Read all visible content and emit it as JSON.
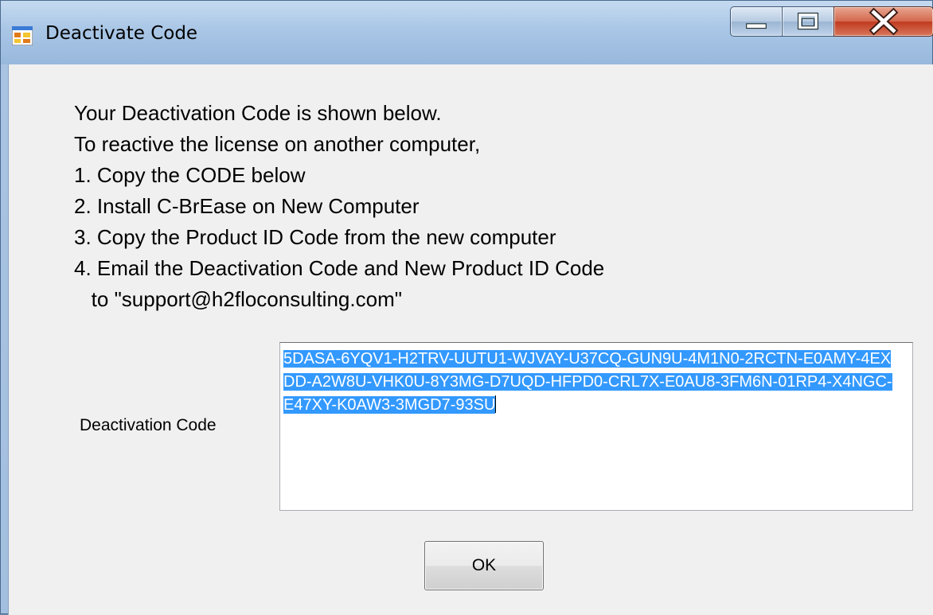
{
  "window": {
    "title": "Deactivate Code",
    "icon": "app-window-icon",
    "controls": [
      "minimize-icon",
      "maximize-icon",
      "close-icon"
    ]
  },
  "instructions": [
    "Your Deactivation Code is shown below.",
    "To reactive the license on another computer,",
    "1. Copy the CODE below",
    "2. Install C-BrEase on New Computer",
    "3. Copy the Product ID Code from the new computer",
    "4. Email the Deactivation Code and New Product ID Code",
    "   to \"support@h2floconsulting.com\""
  ],
  "deactivation": {
    "label": "Deactivation Code",
    "code": "5DASA-6YQV1-H2TRV-UUTU1-WJVAY-U37CQ-GUN9U-4M1N0-2RCTN-E0AMY-4EXDD-A2W8U-VHK0U-8Y3MG-D7UQD-HFPD0-CRL7X-E0AU8-3FM6N-01RP4-X4NGC-E47XY-K0AW3-3MGD7-93SU",
    "selected": true
  },
  "buttons": {
    "ok_label": "OK"
  },
  "colors": {
    "selection": "#3399ff",
    "close_button": "#c8442a",
    "dialog_background": "#f0f0f0"
  }
}
